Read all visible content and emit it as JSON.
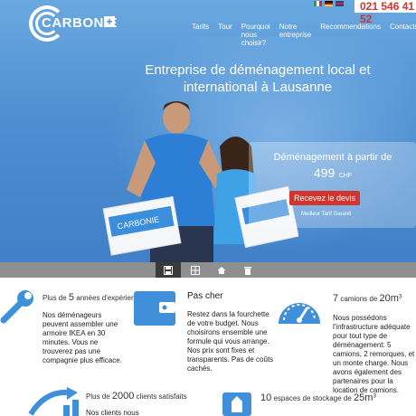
{
  "header": {
    "logo_text": "CARBONIE",
    "logo_plus": "+",
    "phone": "021 546 41 52",
    "languages": [
      "it-flag-icon",
      "de-flag-icon",
      "en-flag-icon"
    ]
  },
  "nav": {
    "items": [
      "Tarifs",
      "Tour",
      "Pourquoi nous choisir?",
      "Notre entreprise",
      "Recommendations",
      "Contacts"
    ]
  },
  "hero": {
    "headline": "Entreprise de déménagement local et international à Lausanne",
    "price_title": "Déménagement à partir de",
    "price_amount": "499",
    "price_currency": "CHF",
    "quote_button": "Recevez le devis",
    "guarantee": "Meilleur Tarif Garanti"
  },
  "toolbar": {
    "buttons": [
      "save-icon",
      "grid-icon",
      "home-icon",
      "trash-icon"
    ]
  },
  "features": [
    {
      "icon": "wrench-icon",
      "label_prefix": "Plus de",
      "label_number": "5",
      "label_suffix": "années d'expérience",
      "text": "Nos déménageurs peuvent assembler une armoire IKEA en 30 minutes. Vous ne trouverez pas une compagnie plus efficace."
    },
    {
      "icon": "wallet-icon",
      "title": "Pas cher",
      "text": "Restez dans la fourchette de votre budget. Nous choisirons ensemble une formule qui vous arrange. Nos prix sont fixes et transparents. Pas de coûts cachés."
    },
    {
      "icon": "gauge-icon",
      "label_number": "7",
      "label_mid": "camions de",
      "label_volume": "20m",
      "label_sup": "3",
      "text": "Nous possédons l'infrastructure adéquate pour tout type de déménagement: 5 camions, 2 remorques, et un monte charge. Nous avons également des partenaires pour la location de camions."
    },
    {
      "icon": "chart-icon",
      "label_prefix": "Plus de",
      "label_number": "2000",
      "label_suffix": "clients satisfaits",
      "text": "Nos clients nous"
    },
    {
      "icon": "storage-icon",
      "label_number": "10",
      "label_mid": "espaces de stockage de",
      "label_volume": "25m",
      "label_sup": "3",
      "text": ""
    }
  ],
  "colors": {
    "hero_blue": "#4d8fd1",
    "accent_red": "#d0352e",
    "icon_blue": "#3f8fdb"
  }
}
